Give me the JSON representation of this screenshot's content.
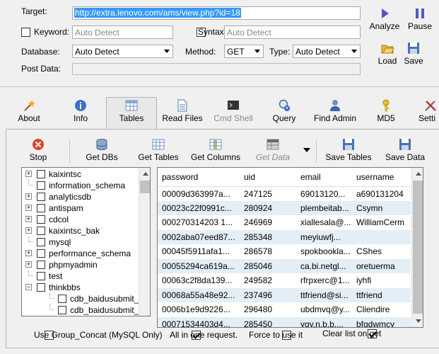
{
  "form": {
    "target_label": "Target:",
    "target_value": "http://extra.lenovo.com/ams/view.php?id=18",
    "keyword_label": "Keyword:",
    "keyword_placeholder": "Auto Detect",
    "syntax_label": "Syntax:",
    "syntax_placeholder": "Auto Detect",
    "database_label": "Database:",
    "database_value": "Auto Detect",
    "method_label": "Method:",
    "method_value": "GET",
    "type_label": "Type:",
    "type_value": "Auto Detect",
    "postdata_label": "Post Data:"
  },
  "actions": {
    "analyze": "Analyze",
    "pause": "Pause",
    "load": "Load",
    "save": "Save"
  },
  "toolbar": {
    "about": "About",
    "info": "Info",
    "tables": "Tables",
    "read_files": "Read Files",
    "cmd_shell": "Cmd Shell",
    "query": "Query",
    "find_admin": "Find Admin",
    "md5": "MD5",
    "settings": "Setti"
  },
  "subtoolbar": {
    "stop": "Stop",
    "get_dbs": "Get DBs",
    "get_tables": "Get Tables",
    "get_columns": "Get Columns",
    "get_data": "Get Data",
    "save_tables": "Save Tables",
    "save_data": "Save Data"
  },
  "tree": [
    {
      "label": "kaixintsc",
      "expander": true,
      "indent": 0
    },
    {
      "label": "information_schema",
      "expander": false,
      "indent": 0
    },
    {
      "label": "analyticsdb",
      "expander": true,
      "indent": 0
    },
    {
      "label": "antispam",
      "expander": true,
      "indent": 0
    },
    {
      "label": "cdcol",
      "expander": true,
      "indent": 0
    },
    {
      "label": "kaixintsc_bak",
      "expander": true,
      "indent": 0
    },
    {
      "label": "mysql",
      "expander": false,
      "indent": 0
    },
    {
      "label": "performance_schema",
      "expander": true,
      "indent": 0
    },
    {
      "label": "phpmyadmin",
      "expander": true,
      "indent": 0
    },
    {
      "label": "test",
      "expander": false,
      "indent": 0
    },
    {
      "label": "thinkbbs",
      "expander": "minus",
      "indent": 0
    },
    {
      "label": "cdb_baidusubmit_settin",
      "expander": false,
      "indent": 1
    },
    {
      "label": "cdb_baidusubmit_sitem",
      "expander": false,
      "indent": 1
    }
  ],
  "grid": {
    "columns": [
      "password",
      "uid",
      "email",
      "username"
    ],
    "rows": [
      [
        "00009d363997a...",
        "247125",
        "69013120...",
        "a690131204"
      ],
      [
        "00023c22f0991c...",
        "280924",
        "plembeitab...",
        "Csymn"
      ],
      [
        "000270314203 1...",
        "246969",
        "xiallesala@...",
        "WilliamCerm"
      ],
      [
        "0002aba07eed87...",
        "285348",
        "meyiuwfj...",
        ""
      ],
      [
        "00045f5911afa1...",
        "286578",
        "spokbookla...",
        "CShes"
      ],
      [
        "00055294ca619a...",
        "285046",
        "ca.bi.netgl...",
        "oretuerma"
      ],
      [
        "00063c2f8da139...",
        "249582",
        "rfrpxerc@1...",
        "iyhfi"
      ],
      [
        "00068a55a48e92...",
        "237496",
        "ttfriend@si...",
        "ttfriend"
      ],
      [
        "0006b1e9d9226...",
        "296480",
        "ubdmvq@y...",
        "Cliendire"
      ],
      [
        "00071534403d4...",
        "285450",
        "vgy.n.b.b....",
        "bfgdwmcy"
      ]
    ]
  },
  "footer": {
    "group_concat": "Use Group_Concat (MySQL Only)",
    "all_in_one": "All in one request.",
    "force": "Force to use it",
    "clear_list": "Clear list on get"
  }
}
